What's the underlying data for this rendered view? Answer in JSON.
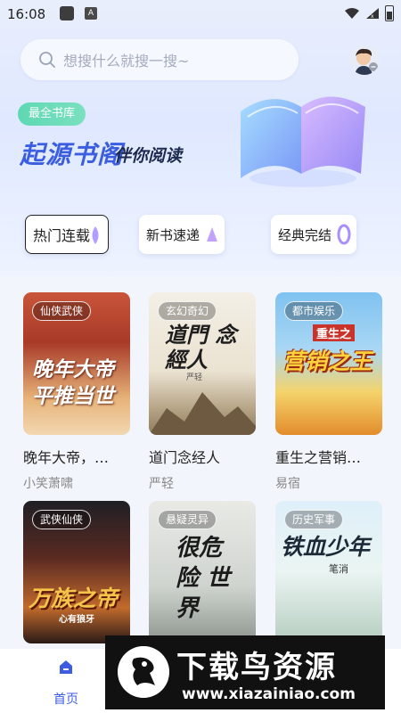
{
  "status_bar": {
    "time": "16:08",
    "notif_letter": "A"
  },
  "search": {
    "placeholder": "想搜什么就搜一搜~"
  },
  "promo": {
    "badge": "最全书库",
    "brand": "起源书阁",
    "slogan": "伴你阅读"
  },
  "categories": [
    {
      "label": "热门连载",
      "selected": true
    },
    {
      "label": "新书速递",
      "selected": false
    },
    {
      "label": "经典完结",
      "selected": false
    }
  ],
  "books": [
    {
      "tag": "仙侠武侠",
      "cover_text": "晚年大帝 平推当世",
      "title": "晚年大帝，…",
      "author": "小笑萧啸"
    },
    {
      "tag": "玄幻奇幻",
      "cover_text": "道門 念經人",
      "cover_sub": "严轻",
      "title": "道门念经人",
      "author": "严轻"
    },
    {
      "tag": "都市娱乐",
      "cover_text": "营销之王",
      "cover_sub": "重生之",
      "title": "重生之营销…",
      "author": "易宿"
    },
    {
      "tag": "武侠仙侠",
      "cover_text": "万族之帝",
      "cover_sub": "心有狼牙",
      "title": "",
      "author": ""
    },
    {
      "tag": "悬疑灵异",
      "cover_text": "很危险 世界",
      "title": "",
      "author": ""
    },
    {
      "tag": "历史军事",
      "cover_text": "铁血少年",
      "cover_sub": "笔消",
      "title": "",
      "author": ""
    }
  ],
  "bottom_nav": {
    "home_label": "首页"
  },
  "watermark": {
    "text": "下载鸟资源",
    "url": "www.xiazainiao.com"
  },
  "colors": {
    "accent": "#3d5ce0",
    "badge": "#5ed8b2"
  }
}
